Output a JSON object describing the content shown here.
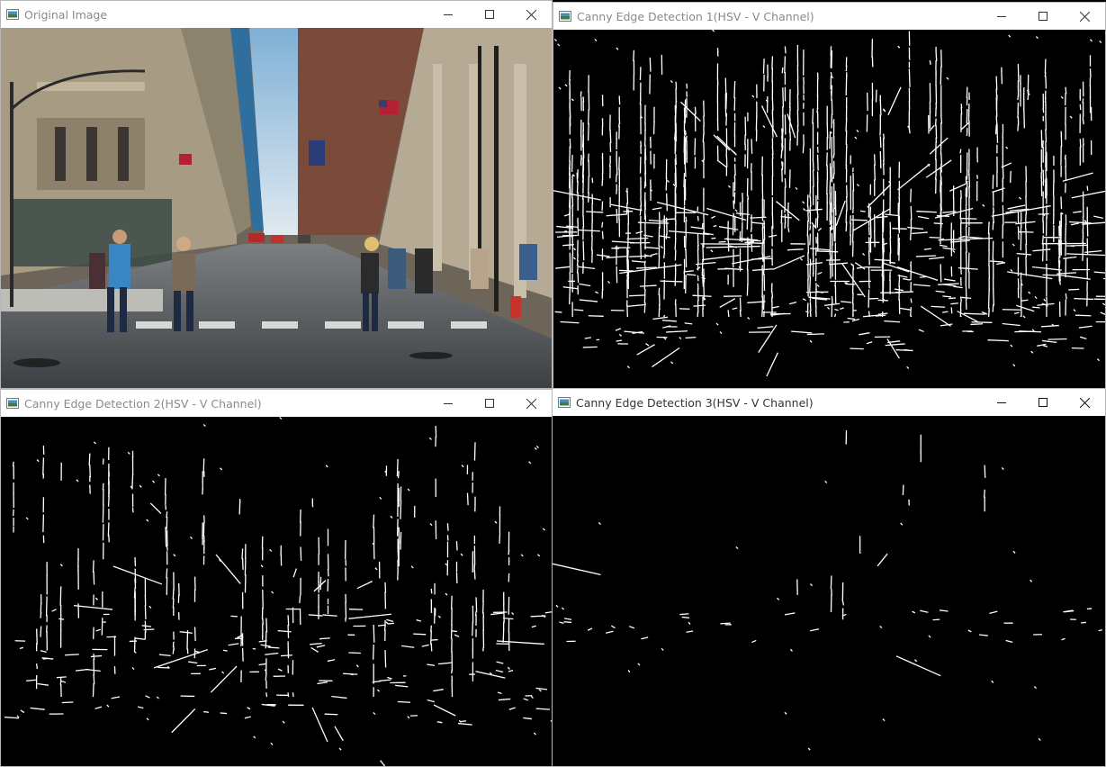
{
  "windows": [
    {
      "id": "original",
      "title": "Original Image"
    },
    {
      "id": "canny1",
      "title": "Canny Edge Detection 1(HSV - V Channel)"
    },
    {
      "id": "canny2",
      "title": "Canny Edge Detection 2(HSV - V Channel)"
    },
    {
      "id": "canny3",
      "title": "Canny Edge Detection 3(HSV - V Channel)"
    }
  ],
  "icons": {
    "app": "window-app-icon",
    "minimize": "minimize-icon",
    "maximize": "maximize-icon",
    "close": "close-icon"
  },
  "colors": {
    "titlebar_bg": "#ffffff",
    "image_bg": "#000000",
    "edge": "#ffffff",
    "sky": "#9ec3dd",
    "road": "#5e6266",
    "building_left": "#a79b84",
    "building_right": "#b6aa95"
  }
}
